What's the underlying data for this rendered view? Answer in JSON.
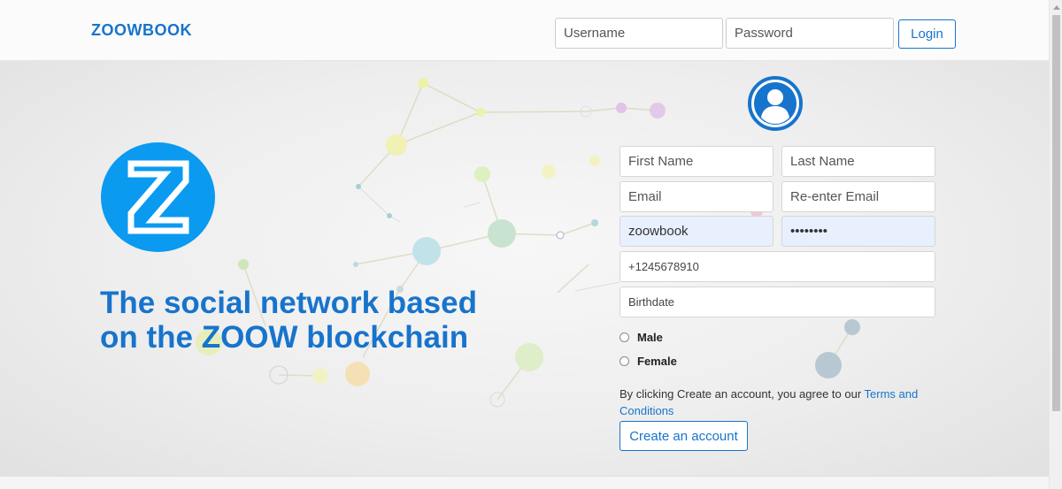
{
  "header": {
    "brand": "ZOOWBOOK",
    "username_placeholder": "Username",
    "password_placeholder": "Password",
    "login_label": "Login"
  },
  "hero": {
    "tagline_line1": "The social network based",
    "tagline_line2": "on the ZOOW blockchain",
    "logo_icon": "z-logo-icon",
    "logo_color": "#0a9af0"
  },
  "signup": {
    "avatar_icon": "user-avatar-icon",
    "first_name_placeholder": "First Name",
    "last_name_placeholder": "Last Name",
    "email_placeholder": "Email",
    "reenter_email_placeholder": "Re-enter Email",
    "username_value": "zoowbook",
    "password_value": "password",
    "phone_placeholder": "+1245678910",
    "birthdate_placeholder": "Birthdate",
    "gender_options": [
      "Male",
      "Female"
    ],
    "terms_prefix": "By clicking Create an account, you agree to our ",
    "terms_link": "Terms and Conditions",
    "create_label": "Create an account"
  },
  "colors": {
    "accent": "#1774cc",
    "autofill": "#e8f0fe"
  }
}
